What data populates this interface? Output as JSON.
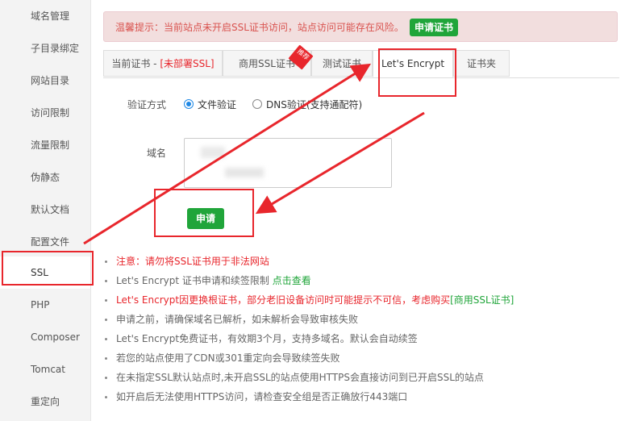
{
  "sidebar": {
    "items": [
      {
        "label": "域名管理"
      },
      {
        "label": "子目录绑定"
      },
      {
        "label": "网站目录"
      },
      {
        "label": "访问限制"
      },
      {
        "label": "流量限制"
      },
      {
        "label": "伪静态"
      },
      {
        "label": "默认文档"
      },
      {
        "label": "配置文件"
      },
      {
        "label": "SSL"
      },
      {
        "label": "PHP"
      },
      {
        "label": "Composer"
      },
      {
        "label": "Tomcat"
      },
      {
        "label": "重定向"
      }
    ],
    "active": "SSL"
  },
  "alert": {
    "text": "温馨提示：当前站点未开启SSL证书访问，站点访问可能存在风险。",
    "button": "申请证书"
  },
  "tabs": {
    "current_prefix": "当前证书 - ",
    "current_status": "[未部署SSL]",
    "commercial": "商用SSL证书",
    "commercial_badge": "推荐",
    "test": "测试证书",
    "letsencrypt": "Let's Encrypt",
    "folder": "证书夹"
  },
  "form": {
    "verify_label": "验证方式",
    "option_file": "文件验证",
    "option_dns": "DNS验证(支持通配符)",
    "domain_label": "域名",
    "submit": "申请"
  },
  "notes": {
    "n1": "注意：请勿将SSL证书用于非法网站",
    "n2_text": "Let's Encrypt 证书申请和续签限制 ",
    "n2_link": "点击查看",
    "n3_text": "Let's Encrypt因更换根证书，部分老旧设备访问时可能提示不可信，考虑购买",
    "n3_link": "[商用SSL证书]",
    "n4": "申请之前，请确保域名已解析，如未解析会导致审核失败",
    "n5": "Let's Encrypt免费证书，有效期3个月，支持多域名。默认会自动续签",
    "n6": "若您的站点使用了CDN或301重定向会导致续签失败",
    "n7": "在未指定SSL默认站点时,未开启SSL的站点使用HTTPS会直接访问到已开启SSL的站点",
    "n8": "如开启后无法使用HTTPS访问，请检查安全组是否正确放行443端口"
  },
  "colors": {
    "accent_green": "#20a53a",
    "warning_red": "#e8262c",
    "radio_blue": "#1e88e5"
  }
}
